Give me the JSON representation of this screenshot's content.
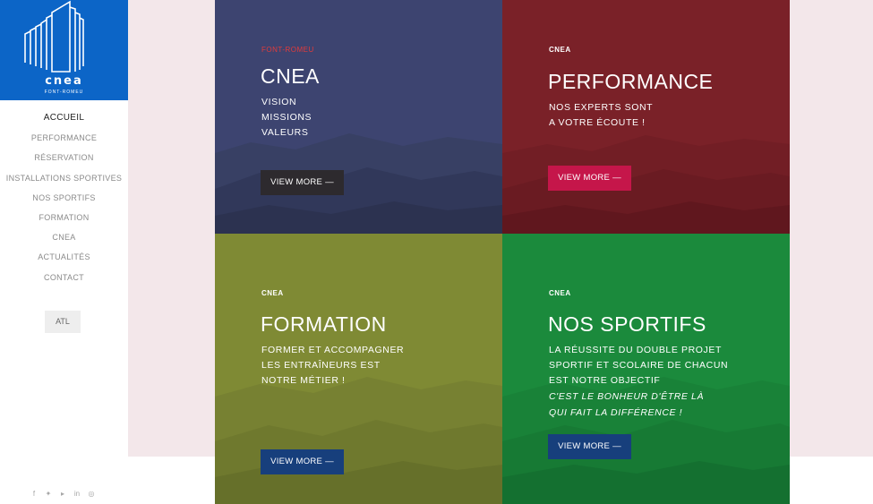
{
  "brand": {
    "name": "cnea",
    "subtitle": "FONT-ROMEU"
  },
  "nav": {
    "items": [
      "ACCUEIL",
      "PERFORMANCE",
      "RÉSERVATION",
      "INSTALLATIONS SPORTIVES",
      "NOS SPORTIFS",
      "FORMATION",
      "CNEA",
      "ACTUALITÉS",
      "CONTACT"
    ],
    "active": "ACCUEIL"
  },
  "lang_button": "ATL",
  "socials": [
    "facebook-icon",
    "twitter-icon",
    "youtube-icon",
    "linkedin-icon",
    "instagram-icon"
  ],
  "tiles": [
    {
      "kicker": "FONT-ROMEU",
      "title": "CNEA",
      "lines": [
        "VISION",
        "MISSIONS",
        "VALEURS"
      ],
      "button": "VIEW MORE —",
      "colors": {
        "bg": "#3d4470",
        "kicker": "#e23b3b",
        "button": "#2d2a2e"
      }
    },
    {
      "kicker": "CNEA",
      "title": "PERFORMANCE",
      "lines": [
        "NOS EXPERTS SONT",
        "A VOTRE ÉCOUTE !"
      ],
      "button": "VIEW MORE —",
      "colors": {
        "bg": "#7a2128",
        "kicker": "#ffffff",
        "button": "#c5164a"
      }
    },
    {
      "kicker": "CNEA",
      "title": "FORMATION",
      "lines": [
        "FORMER ET ACCOMPAGNER",
        "LES ENTRAÎNEURS EST",
        "NOTRE MÉTIER !"
      ],
      "button": "VIEW MORE —",
      "colors": {
        "bg": "#7f8a34",
        "kicker": "#ffffff",
        "button": "#173f7c"
      }
    },
    {
      "kicker": "CNEA",
      "title": "NOS SPORTIFS",
      "lines": [
        "LA RÉUSSITE DU DOUBLE PROJET",
        "SPORTIF ET SCOLAIRE DE CHACUN",
        "EST NOTRE OBJECTIF"
      ],
      "italic_lines": [
        "C'EST LE BONHEUR D'ÊTRE LÀ",
        "QUI FAIT LA DIFFÉRENCE !"
      ],
      "button": "VIEW MORE —",
      "colors": {
        "bg": "#1b8a3c",
        "kicker": "#ffffff",
        "button": "#173f7c"
      }
    }
  ]
}
